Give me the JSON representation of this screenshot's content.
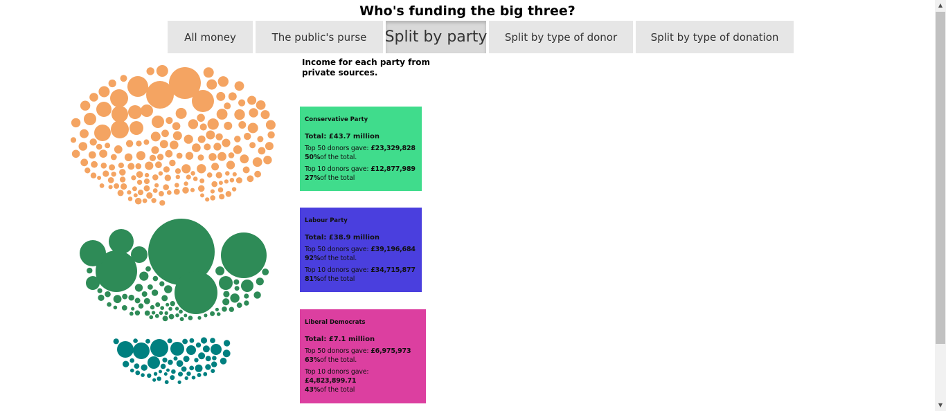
{
  "title": "Who's funding the big three?",
  "tabs": [
    {
      "label": "All money",
      "active": false
    },
    {
      "label": "The public's purse",
      "active": false
    },
    {
      "label": "Split by party",
      "active": true
    },
    {
      "label": "Split by type of donor",
      "active": false
    },
    {
      "label": "Split by type of donation",
      "active": false
    }
  ],
  "subtitle": "Income for each party from private sources.",
  "parties": [
    {
      "name": "Conservative Party",
      "color": "#40dc8c",
      "bubble_color": "#f4a462",
      "total": "Total: £43.7 million",
      "top50_label": "Top 50 donors gave:",
      "top50_value": "£23,329,828",
      "top50_pct": "50%",
      "top50_suffix": "of the total.",
      "top10_label": "Top 10 donors gave:",
      "top10_value": "£12,877,989",
      "top10_pct": "27%",
      "top10_suffix": "of the total"
    },
    {
      "name": "Labour Party",
      "color": "#4a3fde",
      "bubble_color": "#2e8b57",
      "total": "Total: £38.9 million",
      "top50_label": "Top 50 donors gave:",
      "top50_value": "£39,196,684",
      "top50_pct": "92%",
      "top50_suffix": "of the total.",
      "top10_label": "Top 10 donors gave:",
      "top10_value": "£34,715,877",
      "top10_pct": "81%",
      "top10_suffix": "of the total"
    },
    {
      "name": "Liberal Democrats",
      "color": "#dc3fa0",
      "bubble_color": "#008080",
      "total": "Total: £7.1 million",
      "top50_label": "Top 50 donors gave:",
      "top50_value": "£6,975,973",
      "top50_pct": "63%",
      "top50_suffix": "of the total.",
      "top10_label": "Top 10 donors gave:",
      "top10_value": "£4,823,899.71",
      "top10_pct": "43%",
      "top10_suffix": "of the total"
    }
  ]
}
